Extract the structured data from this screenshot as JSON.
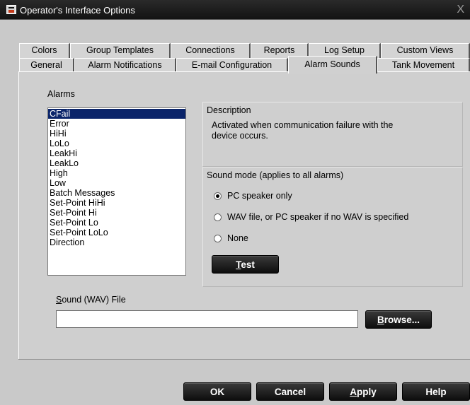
{
  "window": {
    "title": "Operator's Interface Options",
    "close_glyph": "X"
  },
  "tabs_back": [
    "Colors",
    "Group Templates",
    "Connections",
    "Reports",
    "Log Setup",
    "Custom Views"
  ],
  "tabs_front": [
    "General",
    "Alarm Notifications",
    "E-mail Configuration",
    "Alarm Sounds",
    "Tank Movement"
  ],
  "active_tab": "Alarm Sounds",
  "alarms": {
    "label": "Alarms",
    "items": [
      "CFail",
      "Error",
      "HiHi",
      "LoLo",
      "LeakHi",
      "LeakLo",
      "High",
      "Low",
      "Batch Messages",
      "Set-Point HiHi",
      "Set-Point Hi",
      "Set-Point Lo",
      "Set-Point LoLo",
      "Direction"
    ],
    "selected": "CFail"
  },
  "description": {
    "label": "Description",
    "line1": "Activated when communication failure with the",
    "line2": "device occurs."
  },
  "sound_mode": {
    "label": "Sound mode (applies to all alarms)",
    "options": [
      "PC speaker only",
      "WAV file, or PC speaker if no WAV is specified",
      "None"
    ],
    "selected": "PC speaker only"
  },
  "test_button": {
    "accel": "T",
    "rest": "est"
  },
  "wav_file": {
    "label_accel": "S",
    "label_rest": "ound (WAV) File",
    "value": ""
  },
  "browse_button": {
    "accel": "B",
    "rest": "rowse..."
  },
  "footer": {
    "ok": "OK",
    "cancel": "Cancel",
    "apply_accel": "A",
    "apply_rest": "pply",
    "help": "Help"
  }
}
